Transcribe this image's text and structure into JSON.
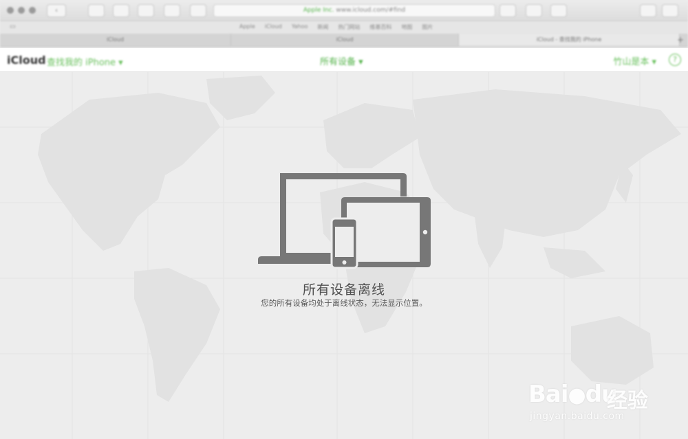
{
  "browser": {
    "back_label": "‹",
    "address": "www.icloud.com/#find",
    "address_secure": "Apple Inc.",
    "bookmarks": [
      "Apple",
      "iCloud",
      "Yahoo",
      "新闻",
      "热门网站",
      "维基百科",
      "地图",
      "图片"
    ],
    "tabs": [
      "iCloud",
      "iCloud",
      "iCloud - 查找我的 iPhone"
    ],
    "new_tab": "+"
  },
  "header": {
    "logo": "iCloud",
    "app_name": "查找我的 iPhone ▾",
    "device_menu": "所有设备 ▾",
    "user_menu": "竹山是本 ▾",
    "help": "?"
  },
  "message": {
    "title": "所有设备离线",
    "subtitle": "您的所有设备均处于离线状态，无法显示位置。"
  },
  "watermark": {
    "brand": "Bai",
    "brand2": "du",
    "brand_cn": "经验",
    "url": "jingyan.baidu.com"
  },
  "colors": {
    "accent": "#54b34a",
    "map_land": "#e3e3e3",
    "map_sea": "#ededed",
    "device_icon": "#777777"
  }
}
